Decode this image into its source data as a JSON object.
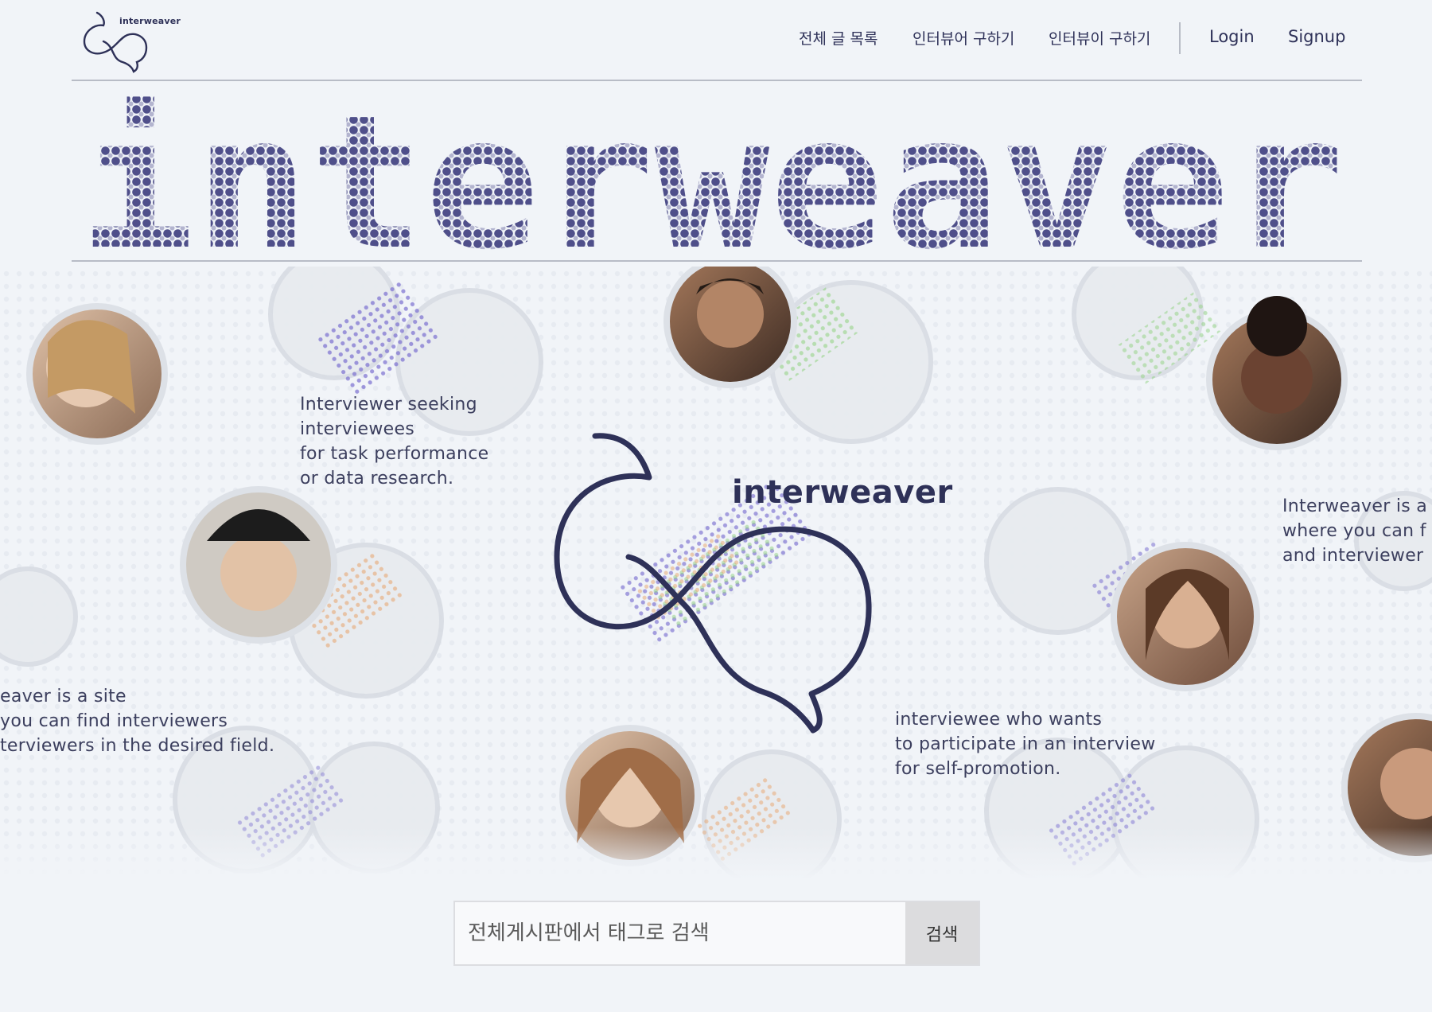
{
  "header": {
    "logo_text": "interweaver",
    "nav": [
      {
        "label": "전체 글 목록"
      },
      {
        "label": "인터뷰어 구하기"
      },
      {
        "label": "인터뷰이 구하기"
      }
    ],
    "login_label": "Login",
    "signup_label": "Signup"
  },
  "hero": {
    "wordmark": "interweaver"
  },
  "collage": {
    "center_logo_text": "interweaver",
    "caption_interviewer": "Interviewer seeking\ninterviewees\nfor task performance\nor data research.",
    "caption_site_left": "eaver is a site\n you can find interviewers\nterviewers in the desired field.",
    "caption_site_right": "Interweaver is a\nwhere you can f\nand interviewer",
    "caption_interviewee": "interviewee who wants\nto participate in an interview\nfor self-promotion."
  },
  "search": {
    "placeholder": "전체게시판에서 태그로 검색",
    "button_label": "검색"
  },
  "colors": {
    "brand_navy": "#2e3158",
    "dot_purple": "#5a5a92",
    "background": "#f1f4f8"
  }
}
